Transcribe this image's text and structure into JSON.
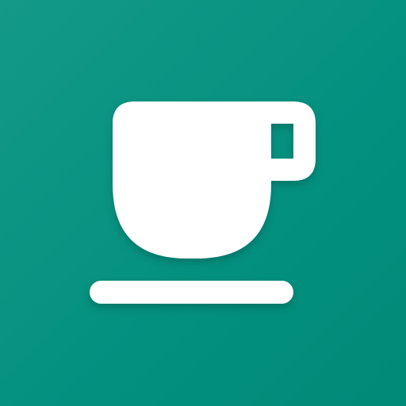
{
  "app_icon": {
    "icon": "coffee-cup-icon",
    "background_color": "#06917f",
    "foreground_color": "#ffffff"
  }
}
